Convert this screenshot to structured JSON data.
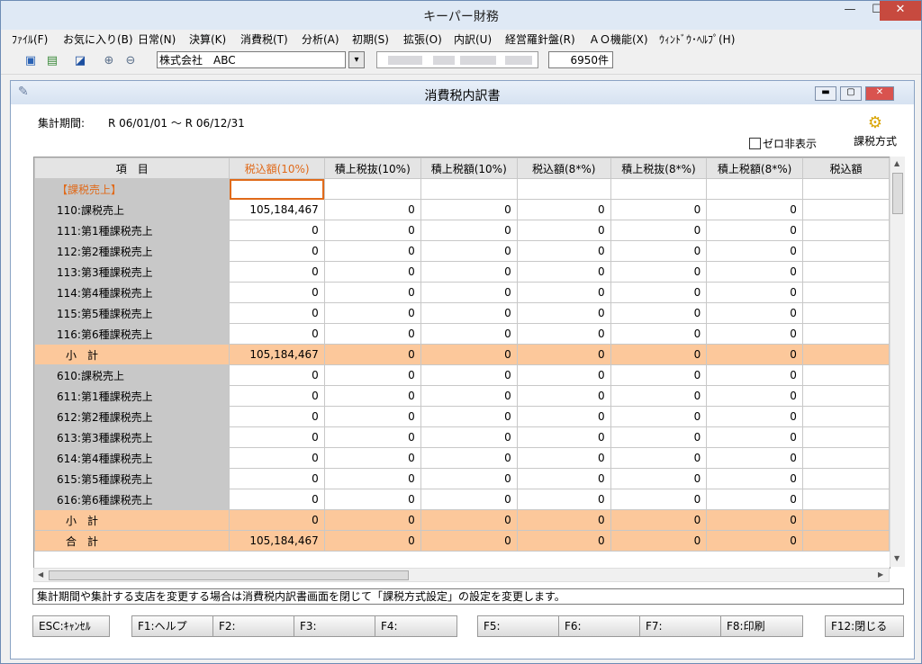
{
  "window": {
    "title": "キーパー財務",
    "minimize": "—",
    "maximize": "☐",
    "close": "✕"
  },
  "menu": [
    "ﾌｧｲﾙ(F)",
    "お気に入り(B)",
    "日常(N)",
    "決算(K)",
    "消費税(T)",
    "分析(A)",
    "初期(S)",
    "拡張(O)",
    "内訳(U)",
    "経営羅針盤(R)",
    "ＡＯ機能(X)",
    "ｳｨﾝﾄﾞｳ･ﾍﾙﾌﾟ(H)"
  ],
  "toolbar": {
    "icons": [
      "save-icon",
      "export-icon",
      "window-icon",
      "zoom-in-icon",
      "zoom-out-icon"
    ],
    "company": "株式会社　ABC",
    "dropdown": "▾",
    "count": "6950件"
  },
  "child": {
    "title": "消費税内訳書",
    "period_label": "集計期間:",
    "period_value": "R 06/01/01 ～ R 06/12/31",
    "zero_hide": "ゼロ非表示",
    "tax_method": "課税方式"
  },
  "table": {
    "headers": [
      "項　目",
      "税込額(10%)",
      "積上税抜(10%)",
      "積上税額(10%)",
      "税込額(8*%)",
      "積上税抜(8*%)",
      "積上税額(8*%)",
      "税込額"
    ],
    "rows": [
      {
        "label": "【課税売上】",
        "values": [
          "",
          "",
          "",
          "",
          "",
          "",
          ""
        ],
        "type": "section"
      },
      {
        "label": "110:課税売上",
        "values": [
          "105,184,467",
          "0",
          "0",
          "0",
          "0",
          "0",
          ""
        ],
        "type": "row"
      },
      {
        "label": "111:第1種課税売上",
        "values": [
          "0",
          "0",
          "0",
          "0",
          "0",
          "0",
          ""
        ],
        "type": "row"
      },
      {
        "label": "112:第2種課税売上",
        "values": [
          "0",
          "0",
          "0",
          "0",
          "0",
          "0",
          ""
        ],
        "type": "row"
      },
      {
        "label": "113:第3種課税売上",
        "values": [
          "0",
          "0",
          "0",
          "0",
          "0",
          "0",
          ""
        ],
        "type": "row"
      },
      {
        "label": "114:第4種課税売上",
        "values": [
          "0",
          "0",
          "0",
          "0",
          "0",
          "0",
          ""
        ],
        "type": "row"
      },
      {
        "label": "115:第5種課税売上",
        "values": [
          "0",
          "0",
          "0",
          "0",
          "0",
          "0",
          ""
        ],
        "type": "row"
      },
      {
        "label": "116:第6種課税売上",
        "values": [
          "0",
          "0",
          "0",
          "0",
          "0",
          "0",
          ""
        ],
        "type": "row"
      },
      {
        "label": "小　計",
        "values": [
          "105,184,467",
          "0",
          "0",
          "0",
          "0",
          "0",
          ""
        ],
        "type": "sub"
      },
      {
        "label": "610:課税売上",
        "values": [
          "0",
          "0",
          "0",
          "0",
          "0",
          "0",
          ""
        ],
        "type": "row"
      },
      {
        "label": "611:第1種課税売上",
        "values": [
          "0",
          "0",
          "0",
          "0",
          "0",
          "0",
          ""
        ],
        "type": "row"
      },
      {
        "label": "612:第2種課税売上",
        "values": [
          "0",
          "0",
          "0",
          "0",
          "0",
          "0",
          ""
        ],
        "type": "row"
      },
      {
        "label": "613:第3種課税売上",
        "values": [
          "0",
          "0",
          "0",
          "0",
          "0",
          "0",
          ""
        ],
        "type": "row"
      },
      {
        "label": "614:第4種課税売上",
        "values": [
          "0",
          "0",
          "0",
          "0",
          "0",
          "0",
          ""
        ],
        "type": "row"
      },
      {
        "label": "615:第5種課税売上",
        "values": [
          "0",
          "0",
          "0",
          "0",
          "0",
          "0",
          ""
        ],
        "type": "row"
      },
      {
        "label": "616:第6種課税売上",
        "values": [
          "0",
          "0",
          "0",
          "0",
          "0",
          "0",
          ""
        ],
        "type": "row"
      },
      {
        "label": "小　計",
        "values": [
          "0",
          "0",
          "0",
          "0",
          "0",
          "0",
          ""
        ],
        "type": "sub"
      },
      {
        "label": "合　計",
        "values": [
          "105,184,467",
          "0",
          "0",
          "0",
          "0",
          "0",
          ""
        ],
        "type": "sub"
      }
    ]
  },
  "note": "集計期間や集計する支店を変更する場合は消費税内訳書画面を閉じて「課税方式設定」の設定を変更します。",
  "fkeys": [
    "ESC:ｷｬﾝｾﾙ",
    "F1:ヘルプ",
    "F2:",
    "F3:",
    "F4:",
    "F5:",
    "F6:",
    "F7:",
    "F8:印刷",
    "F12:閉じる"
  ],
  "colors": {
    "accent": "#e06a1a",
    "subtotal": "#fcc89b"
  }
}
